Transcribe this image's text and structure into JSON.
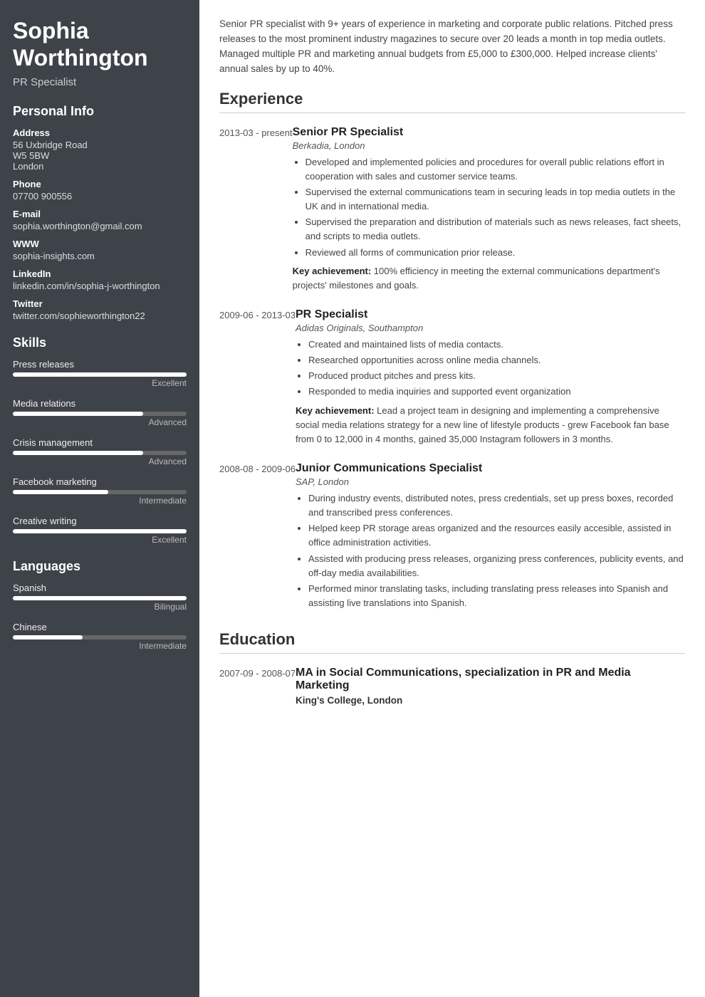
{
  "sidebar": {
    "name": "Sophia Worthington",
    "title": "PR Specialist",
    "personal_info": {
      "section_title": "Personal Info",
      "address_label": "Address",
      "address_lines": [
        "56 Uxbridge Road",
        "W5 5BW",
        "London"
      ],
      "phone_label": "Phone",
      "phone": "07700 900556",
      "email_label": "E-mail",
      "email": "sophia.worthington@gmail.com",
      "www_label": "WWW",
      "www": "sophia-insights.com",
      "linkedin_label": "LinkedIn",
      "linkedin": "linkedin.com/in/sophia-j-worthington",
      "twitter_label": "Twitter",
      "twitter": "twitter.com/sophieworthington22"
    },
    "skills_section_title": "Skills",
    "skills": [
      {
        "name": "Press releases",
        "fill_pct": 100,
        "level": "Excellent"
      },
      {
        "name": "Media relations",
        "fill_pct": 75,
        "level": "Advanced"
      },
      {
        "name": "Crisis management",
        "fill_pct": 75,
        "level": "Advanced"
      },
      {
        "name": "Facebook marketing",
        "fill_pct": 55,
        "level": "Intermediate"
      },
      {
        "name": "Creative writing",
        "fill_pct": 100,
        "level": "Excellent"
      }
    ],
    "languages_section_title": "Languages",
    "languages": [
      {
        "name": "Spanish",
        "fill_pct": 100,
        "level": "Bilingual"
      },
      {
        "name": "Chinese",
        "fill_pct": 40,
        "level": "Intermediate"
      }
    ]
  },
  "main": {
    "summary": "Senior PR specialist with 9+ years of experience in marketing and corporate public relations. Pitched press releases to the most prominent industry magazines to secure over 20 leads a month in top media outlets. Managed multiple PR and marketing annual budgets from £5,000 to £300,000. Helped increase clients' annual sales by up to 40%.",
    "experience_title": "Experience",
    "experience": [
      {
        "date": "2013-03 - present",
        "title": "Senior PR Specialist",
        "company": "Berkadia, London",
        "bullets": [
          "Developed and implemented policies and procedures for overall public relations effort in cooperation with sales and customer service teams.",
          "Supervised the external communications team in securing leads in top media outlets in the UK and in international media.",
          "Supervised the preparation and distribution of materials such as news releases, fact sheets, and scripts to media outlets.",
          "Reviewed all forms of communication prior release."
        ],
        "key_achievement": "100% efficiency in meeting the external communications department's projects' milestones and goals."
      },
      {
        "date": "2009-06 - 2013-03",
        "title": "PR Specialist",
        "company": "Adidas Originals, Southampton",
        "bullets": [
          "Created and maintained lists of media contacts.",
          "Researched opportunities across online media channels.",
          "Produced product pitches and press kits.",
          "Responded to media inquiries and supported event organization"
        ],
        "key_achievement": "Lead a project team in designing and implementing a comprehensive social media relations strategy for a new line of lifestyle products - grew Facebook fan base from 0 to 12,000 in 4 months, gained 35,000 Instagram followers in 3 months."
      },
      {
        "date": "2008-08 - 2009-06",
        "title": "Junior Communications Specialist",
        "company": "SAP, London",
        "bullets": [
          "During industry events, distributed notes, press credentials, set up press boxes, recorded and transcribed press conferences.",
          "Helped keep PR storage areas organized and the resources easily accesible, assisted in office administration activities.",
          "Assisted with producing press releases, organizing press conferences, publicity events, and off-day media availabilities.",
          "Performed minor translating tasks, including translating press releases into Spanish and assisting live translations into Spanish."
        ],
        "key_achievement": ""
      }
    ],
    "education_title": "Education",
    "education": [
      {
        "date": "2007-09 - 2008-07",
        "degree": "MA in Social Communications, specialization in PR and Media Marketing",
        "school": "King's College, London"
      }
    ]
  }
}
